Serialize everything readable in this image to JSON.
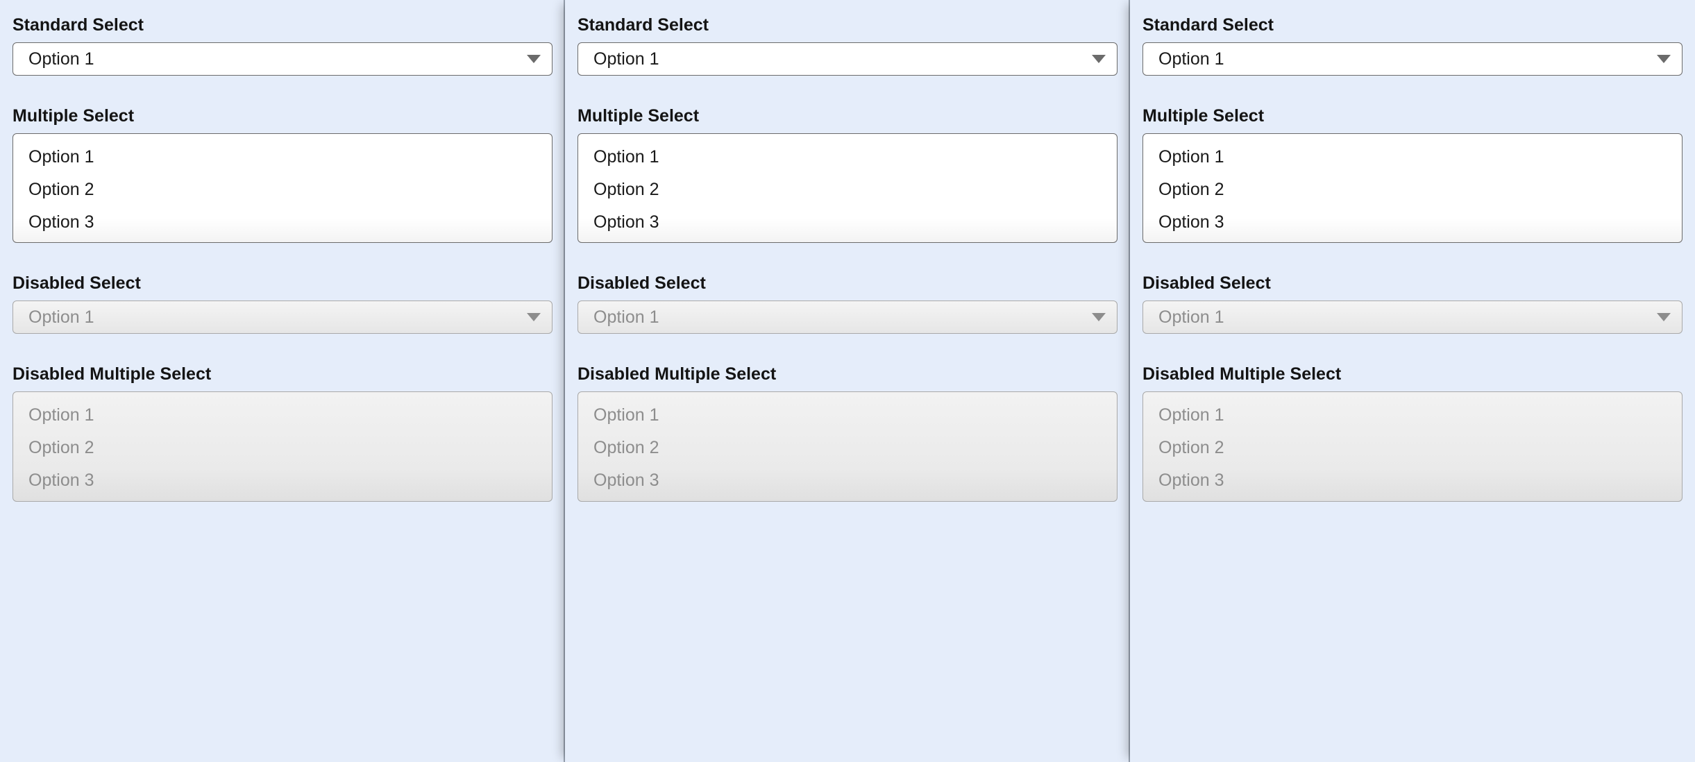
{
  "labels": {
    "standard": "Standard Select",
    "multiple": "Multiple Select",
    "disabled": "Disabled Select",
    "disabled_multiple": "Disabled Multiple Select"
  },
  "options": {
    "opt1": "Option 1",
    "opt2": "Option 2",
    "opt3": "Option 3"
  },
  "selected": {
    "standard": "Option 1",
    "disabled": "Option 1"
  }
}
